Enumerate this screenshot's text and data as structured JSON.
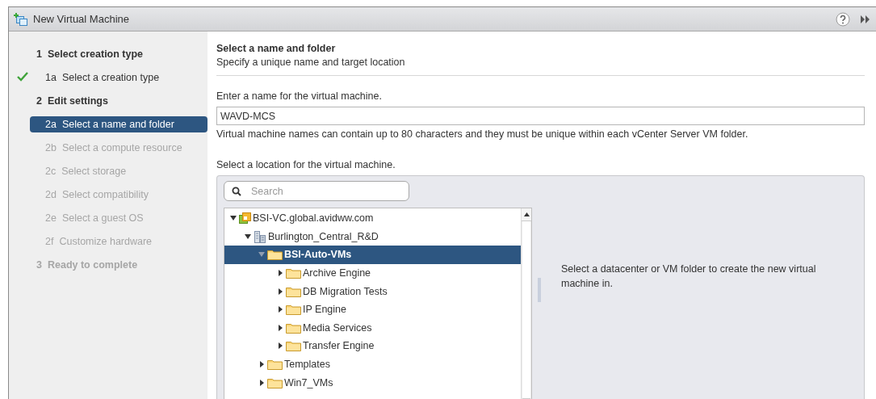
{
  "window": {
    "title": "New Virtual Machine"
  },
  "steps": [
    {
      "kind": "section",
      "number": "1",
      "label": "Select creation type",
      "completed": false,
      "selected": false,
      "disabled": false
    },
    {
      "kind": "substep",
      "number": "1a",
      "label": "Select a creation type",
      "completed": true,
      "selected": false,
      "disabled": false
    },
    {
      "kind": "section",
      "number": "2",
      "label": "Edit settings",
      "completed": false,
      "selected": false,
      "disabled": false
    },
    {
      "kind": "substep",
      "number": "2a",
      "label": "Select a name and folder",
      "completed": false,
      "selected": true,
      "disabled": false
    },
    {
      "kind": "substep",
      "number": "2b",
      "label": "Select a compute resource",
      "completed": false,
      "selected": false,
      "disabled": true
    },
    {
      "kind": "substep",
      "number": "2c",
      "label": "Select storage",
      "completed": false,
      "selected": false,
      "disabled": true
    },
    {
      "kind": "substep",
      "number": "2d",
      "label": "Select compatibility",
      "completed": false,
      "selected": false,
      "disabled": true
    },
    {
      "kind": "substep",
      "number": "2e",
      "label": "Select a guest OS",
      "completed": false,
      "selected": false,
      "disabled": true
    },
    {
      "kind": "substep",
      "number": "2f",
      "label": "Customize hardware",
      "completed": false,
      "selected": false,
      "disabled": true
    },
    {
      "kind": "section",
      "number": "3",
      "label": "Ready to complete",
      "completed": false,
      "selected": false,
      "disabled": true
    }
  ],
  "page": {
    "title": "Select a name and folder",
    "subtitle": "Specify a unique name and target location"
  },
  "name_field": {
    "label": "Enter a name for the virtual machine.",
    "value": "WAVD-MCS",
    "note": "Virtual machine names can contain up to 80 characters and they must be unique within each vCenter Server VM folder."
  },
  "location": {
    "label": "Select a location for the virtual machine.",
    "search": {
      "placeholder": "Search"
    },
    "tree": [
      {
        "label": "BSI-VC.global.avidww.com",
        "kind": "vcenter",
        "expanded": true,
        "selected": false,
        "children": [
          {
            "label": "Burlington_Central_R&D",
            "kind": "datacenter",
            "expanded": true,
            "selected": false,
            "children": [
              {
                "label": "BSI-Auto-VMs",
                "kind": "folder",
                "expanded": true,
                "selected": true,
                "children": [
                  {
                    "label": "Archive Engine",
                    "kind": "folder",
                    "expanded": false,
                    "selected": false
                  },
                  {
                    "label": "DB Migration Tests",
                    "kind": "folder",
                    "expanded": false,
                    "selected": false
                  },
                  {
                    "label": "IP Engine",
                    "kind": "folder",
                    "expanded": false,
                    "selected": false
                  },
                  {
                    "label": "Media Services",
                    "kind": "folder",
                    "expanded": false,
                    "selected": false
                  },
                  {
                    "label": "Transfer Engine",
                    "kind": "folder",
                    "expanded": false,
                    "selected": false
                  }
                ]
              },
              {
                "label": "Templates",
                "kind": "folder",
                "expanded": false,
                "selected": false
              },
              {
                "label": "Win7_VMs",
                "kind": "folder",
                "expanded": false,
                "selected": false
              }
            ]
          }
        ]
      }
    ],
    "message": "Select a datacenter or VM folder to create the new virtual machine in."
  }
}
